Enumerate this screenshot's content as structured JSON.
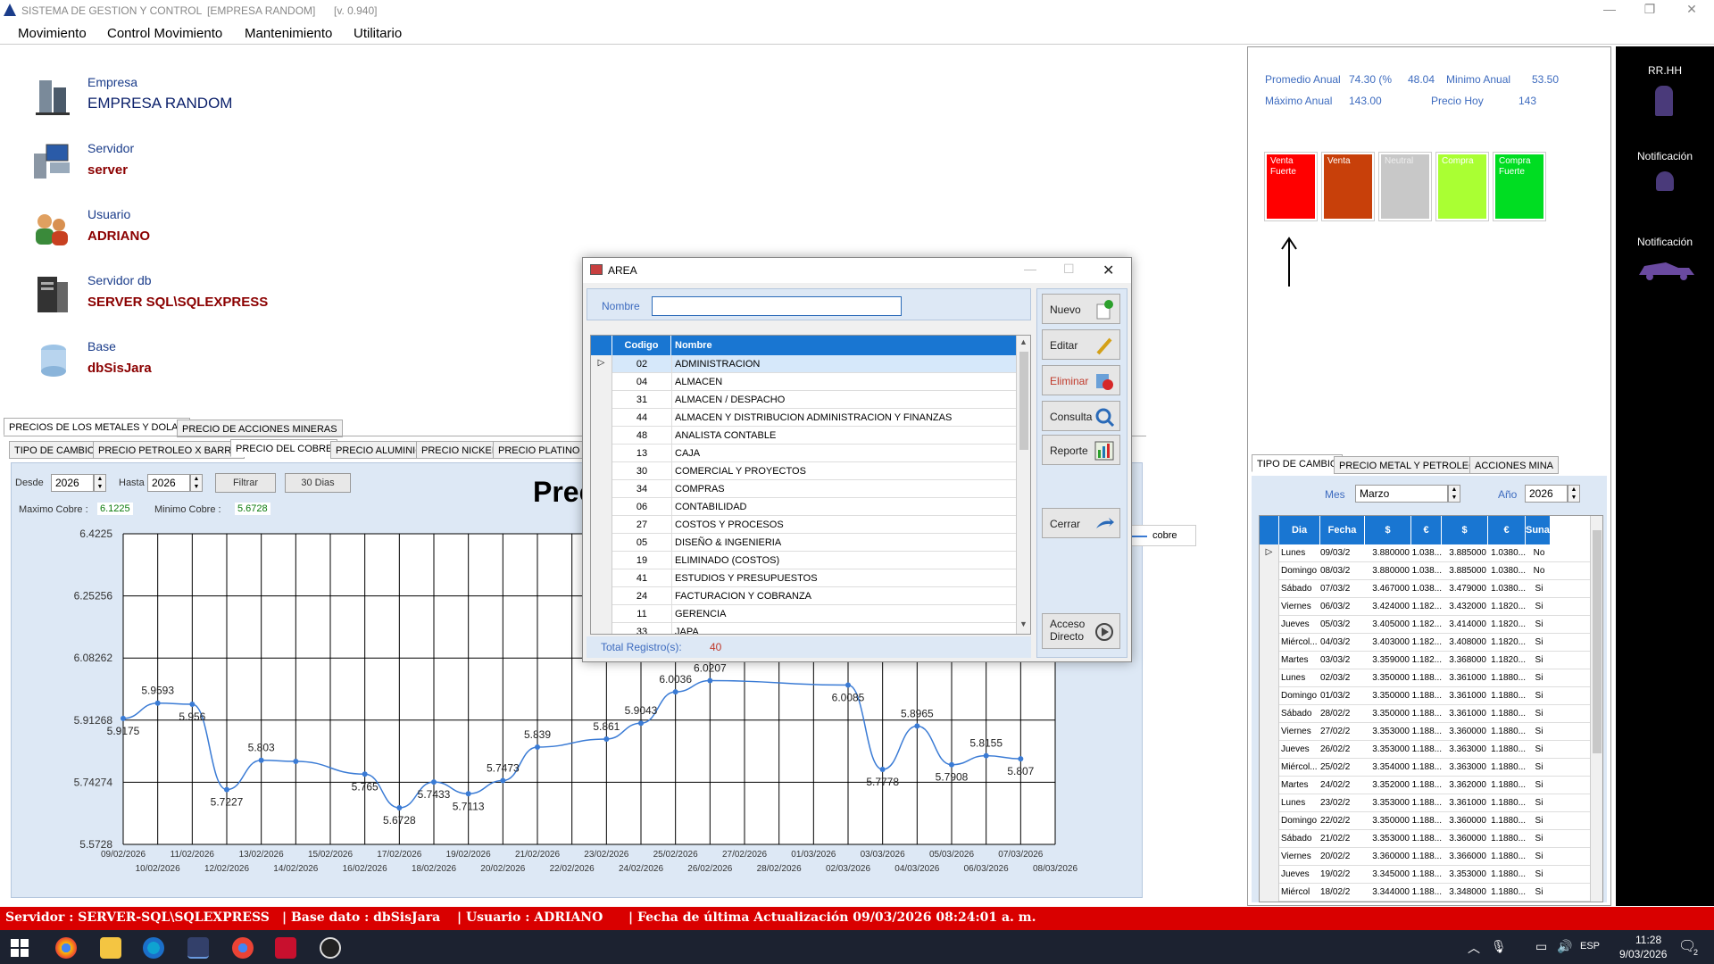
{
  "window": {
    "title": "SISTEMA DE GESTION Y CONTROL",
    "company_tag": "[EMPRESA RANDOM]",
    "version": "[v. 0.940]"
  },
  "menu": [
    "Movimiento",
    "Control Movimiento",
    "Mantenimiento",
    "Utilitario"
  ],
  "info": {
    "empresa_label": "Empresa",
    "empresa_value": "EMPRESA RANDOM",
    "servidor_label": "Servidor",
    "servidor_value": "server",
    "usuario_label": "Usuario",
    "usuario_value": "ADRIANO",
    "servidordb_label": "Servidor db",
    "servidordb_value": "SERVER SQL\\SQLEXPRESS",
    "base_label": "Base",
    "base_value": "dbSisJara"
  },
  "main_tabs": [
    "PRECIOS DE LOS METALES Y DOLAR",
    "PRECIO DE ACCIONES MINERAS"
  ],
  "sub_tabs": [
    "TIPO DE CAMBIO",
    "PRECIO PETROLEO X BARRIL",
    "PRECIO DEL COBRE",
    "PRECIO ALUMINIO",
    "PRECIO NICKEL",
    "PRECIO PLATINO"
  ],
  "filter": {
    "desde_label": "Desde",
    "desde_value": "2026",
    "hasta_label": "Hasta",
    "hasta_value": "2026",
    "filtrar_label": "Filtrar",
    "dias_label": "30 Dias",
    "maximo_label": "Maximo Cobre :",
    "maximo_value": "6.1225",
    "minimo_label": "Minimo Cobre :",
    "minimo_value": "5.6728"
  },
  "chart_title_partial": "Prec",
  "legend_label": "cobre",
  "chart_data": {
    "type": "line",
    "ylim": [
      5.5728,
      6.4225
    ],
    "yticks": [
      "6.4225",
      "6.25256",
      "6.08262",
      "5.91268",
      "5.74274",
      "5.5728"
    ],
    "xticks_top": [
      "09/02/2026",
      "11/02/2026",
      "13/02/2026",
      "15/02/2026",
      "17/02/2026",
      "19/02/2026",
      "21/02/2026",
      "23/02/2026",
      "25/02/2026",
      "27/02/2026",
      "01/03/2026",
      "03/03/2026",
      "05/03/2026",
      "07/03/2026"
    ],
    "xticks_bottom": [
      "10/02/2026",
      "12/02/2026",
      "14/02/2026",
      "16/02/2026",
      "18/02/2026",
      "20/02/2026",
      "22/02/2026",
      "24/02/2026",
      "26/02/2026",
      "28/02/2026",
      "02/03/2026",
      "04/03/2026",
      "06/03/2026",
      "08/03/2026"
    ],
    "series": [
      {
        "name": "cobre",
        "x": [
          "09/02/2026",
          "10/02/2026",
          "11/02/2026",
          "12/02/2026",
          "13/02/2026",
          "14/02/2026",
          "16/02/2026",
          "17/02/2026",
          "18/02/2026",
          "19/02/2026",
          "20/02/2026",
          "21/02/2026",
          "23/02/2026",
          "24/02/2026",
          "25/02/2026",
          "26/02/2026",
          "02/03/2026",
          "03/03/2026",
          "04/03/2026",
          "05/03/2026",
          "06/03/2026",
          "07/03/2026"
        ],
        "y": [
          5.9175,
          5.9593,
          5.956,
          5.7227,
          5.803,
          5.8,
          5.765,
          5.6728,
          5.7433,
          5.7113,
          5.7473,
          5.839,
          5.861,
          5.9043,
          5.99,
          6.0207,
          6.0085,
          5.7778,
          5.8965,
          5.7908,
          5.8155,
          5.807
        ],
        "labels": [
          "5.9175",
          "5.9593",
          "5.956",
          "5.7227",
          "5.803",
          "",
          "5.765",
          "5.6728",
          "5.7433",
          "5.7113",
          "5.7473",
          "5.839",
          "5.861",
          "5.9043",
          "6.0036",
          "6.0207",
          "6.0085",
          "5.7778",
          "5.8965",
          "5.7908",
          "5.8155",
          "5.807"
        ]
      }
    ]
  },
  "right_stats": {
    "promedio_label": "Promedio Anual",
    "promedio_value": "74.30 (%",
    "pct_value": "48.04",
    "minimo_label": "Minimo Anual",
    "minimo_value": "53.50",
    "maximo_label": "Máximo Anual",
    "maximo_value": "143.00",
    "hoy_label": "Precio Hoy",
    "hoy_value": "143"
  },
  "signals": [
    {
      "label": "Venta Fuerte",
      "color": "#ff0000"
    },
    {
      "label": "Venta",
      "color": "#c8400a"
    },
    {
      "label": "Neutral",
      "color": "#c8c8c8"
    },
    {
      "label": "Compra",
      "color": "#aaff33"
    },
    {
      "label": "Compra Fuerte",
      "color": "#00dd22"
    }
  ],
  "right_tabs": [
    "TIPO DE CAMBIO",
    "PRECIO METAL Y PETROLEO",
    "ACCIONES MINA"
  ],
  "right_filter": {
    "mes_label": "Mes",
    "mes_value": "Marzo",
    "anio_label": "Año",
    "anio_value": "2026"
  },
  "right_grid": {
    "headers": [
      "Dia",
      "Fecha",
      "$",
      "€",
      "$",
      "€",
      "Sunat"
    ],
    "rows": [
      [
        "Lunes",
        "09/03/2",
        "3.880000",
        "1.038...",
        "3.885000",
        "1.0380...",
        "No"
      ],
      [
        "Domingo",
        "08/03/2",
        "3.880000",
        "1.038...",
        "3.885000",
        "1.0380...",
        "No"
      ],
      [
        "Sábado",
        "07/03/2",
        "3.467000",
        "1.038...",
        "3.479000",
        "1.0380...",
        "Si"
      ],
      [
        "Viernes",
        "06/03/2",
        "3.424000",
        "1.182...",
        "3.432000",
        "1.1820...",
        "Si"
      ],
      [
        "Jueves",
        "05/03/2",
        "3.405000",
        "1.182...",
        "3.414000",
        "1.1820...",
        "Si"
      ],
      [
        "Miércol...",
        "04/03/2",
        "3.403000",
        "1.182...",
        "3.408000",
        "1.1820...",
        "Si"
      ],
      [
        "Martes",
        "03/03/2",
        "3.359000",
        "1.182...",
        "3.368000",
        "1.1820...",
        "Si"
      ],
      [
        "Lunes",
        "02/03/2",
        "3.350000",
        "1.188...",
        "3.361000",
        "1.1880...",
        "Si"
      ],
      [
        "Domingo",
        "01/03/2",
        "3.350000",
        "1.188...",
        "3.361000",
        "1.1880...",
        "Si"
      ],
      [
        "Sábado",
        "28/02/2",
        "3.350000",
        "1.188...",
        "3.361000",
        "1.1880...",
        "Si"
      ],
      [
        "Viernes",
        "27/02/2",
        "3.353000",
        "1.188...",
        "3.360000",
        "1.1880...",
        "Si"
      ],
      [
        "Jueves",
        "26/02/2",
        "3.353000",
        "1.188...",
        "3.363000",
        "1.1880...",
        "Si"
      ],
      [
        "Miércol...",
        "25/02/2",
        "3.354000",
        "1.188...",
        "3.363000",
        "1.1880...",
        "Si"
      ],
      [
        "Martes",
        "24/02/2",
        "3.352000",
        "1.188...",
        "3.362000",
        "1.1880...",
        "Si"
      ],
      [
        "Lunes",
        "23/02/2",
        "3.353000",
        "1.188...",
        "3.361000",
        "1.1880...",
        "Si"
      ],
      [
        "Domingo",
        "22/02/2",
        "3.350000",
        "1.188...",
        "3.360000",
        "1.1880...",
        "Si"
      ],
      [
        "Sábado",
        "21/02/2",
        "3.353000",
        "1.188...",
        "3.360000",
        "1.1880...",
        "Si"
      ],
      [
        "Viernes",
        "20/02/2",
        "3.360000",
        "1.188...",
        "3.366000",
        "1.1880...",
        "Si"
      ],
      [
        "Jueves",
        "19/02/2",
        "3.345000",
        "1.188...",
        "3.353000",
        "1.1880...",
        "Si"
      ],
      [
        "Miércol",
        "18/02/2",
        "3.344000",
        "1.188...",
        "3.348000",
        "1.1880...",
        "Si"
      ]
    ]
  },
  "sidebar": [
    "RR.HH",
    "Notificación",
    "Notificación"
  ],
  "dialog": {
    "title": "AREA",
    "nombre_label": "Nombre",
    "nombre_value": "",
    "grid_headers": [
      "Codigo",
      "Nombre"
    ],
    "rows": [
      [
        "02",
        "ADMINISTRACION"
      ],
      [
        "04",
        "ALMACEN"
      ],
      [
        "31",
        "ALMACEN / DESPACHO"
      ],
      [
        "44",
        "ALMACEN Y DISTRIBUCION ADMINISTRACION Y FINANZAS"
      ],
      [
        "48",
        "ANALISTA CONTABLE"
      ],
      [
        "13",
        "CAJA"
      ],
      [
        "30",
        "COMERCIAL Y PROYECTOS"
      ],
      [
        "34",
        "COMPRAS"
      ],
      [
        "06",
        "CONTABILIDAD"
      ],
      [
        "27",
        "COSTOS Y PROCESOS"
      ],
      [
        "05",
        "DISEÑO & INGENIERIA"
      ],
      [
        "19",
        "ELIMINADO (COSTOS)"
      ],
      [
        "41",
        "ESTUDIOS Y PRESUPUESTOS"
      ],
      [
        "24",
        "FACTURACION Y COBRANZA"
      ],
      [
        "11",
        "GERENCIA"
      ],
      [
        "33",
        "JAPA"
      ]
    ],
    "total_label": "Total Registro(s):",
    "total_value": "40",
    "buttons": {
      "nuevo": "Nuevo",
      "editar": "Editar",
      "eliminar": "Eliminar",
      "consulta": "Consulta",
      "reporte": "Reporte",
      "cerrar": "Cerrar",
      "acceso": "Acceso Directo"
    }
  },
  "statusbar": {
    "servidor": "Servidor : SERVER-SQL\\SQLEXPRESS",
    "base": "| Base dato : dbSisJara",
    "usuario": "| Usuario : ADRIANO",
    "fecha": "| Fecha de última Actualización 09/03/2026 08:24:01 a. m."
  },
  "taskbar": {
    "time": "11:28",
    "date": "9/03/2026",
    "lang": "ESP",
    "notif_count": "2"
  }
}
